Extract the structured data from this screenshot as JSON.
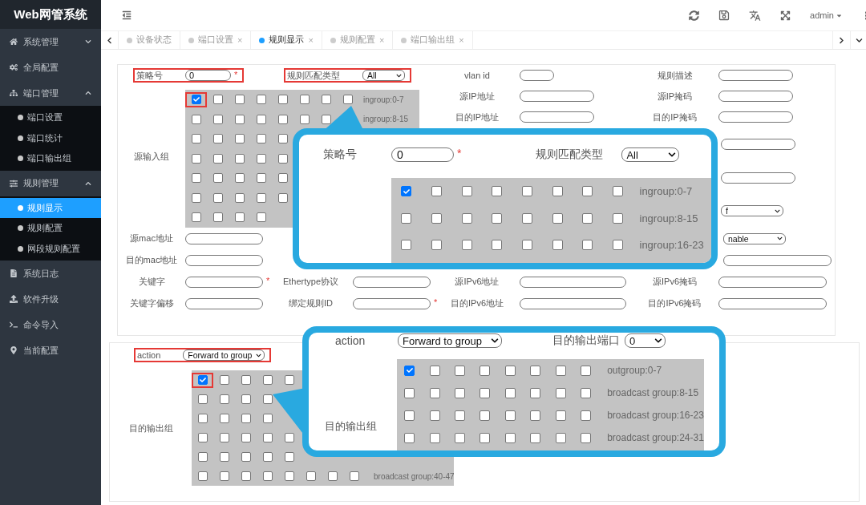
{
  "sidebar": {
    "title": "Web网管系统",
    "items": [
      {
        "label": "系统管理",
        "expanded": false
      },
      {
        "label": "全局配置"
      },
      {
        "label": "端口管理",
        "expanded": true,
        "children": [
          {
            "label": "端口设置",
            "selected": false
          },
          {
            "label": "端口统计",
            "selected": false
          },
          {
            "label": "端口输出组",
            "selected": false
          }
        ]
      },
      {
        "label": "规则管理",
        "expanded": true,
        "children": [
          {
            "label": "规则显示",
            "selected": true
          },
          {
            "label": "规则配置",
            "selected": false
          },
          {
            "label": "网段规则配置",
            "selected": false
          }
        ]
      },
      {
        "label": "系统日志"
      },
      {
        "label": "软件升级"
      },
      {
        "label": "命令导入"
      },
      {
        "label": "当前配置"
      }
    ]
  },
  "topbar": {
    "user": "admin"
  },
  "tabs": [
    {
      "label": "设备状态",
      "selected": false
    },
    {
      "label": "端口设置",
      "selected": false,
      "close": "×"
    },
    {
      "label": "规则显示",
      "selected": true,
      "close": "×"
    },
    {
      "label": "规则配置",
      "selected": false,
      "close": "×"
    },
    {
      "label": "端口输出组",
      "selected": false,
      "close": "×"
    }
  ],
  "rule_form": {
    "top_row": [
      {
        "label": "策略号",
        "field": {
          "kind": "input",
          "value": "0"
        },
        "mark": "*",
        "highlighted": true
      },
      {
        "label": "规则匹配类型",
        "field": {
          "kind": "select",
          "value": "All"
        },
        "highlighted": true
      },
      {
        "label": "vlan id",
        "field": {
          "kind": "input"
        }
      },
      {
        "label": "规则描述",
        "field": {
          "kind": "input"
        }
      }
    ],
    "input_group": {
      "label": "源输入组",
      "rows": [
        {
          "boxes": [
            {
              "checked": true,
              "highlighted": true
            },
            {
              "checked": false
            },
            {
              "checked": false
            },
            {
              "checked": false
            },
            {
              "checked": false
            },
            {
              "checked": false
            },
            {
              "checked": false
            },
            {
              "checked": false
            }
          ],
          "label": "ingroup:0-7"
        },
        {
          "boxes": [
            {
              "checked": false
            },
            {
              "checked": false
            },
            {
              "checked": false
            },
            {
              "checked": false
            },
            {
              "checked": false
            },
            {
              "checked": false
            },
            {
              "checked": false
            }
          ],
          "label": "ingroup:8-15"
        },
        {
          "boxes": [
            {
              "checked": false
            },
            {
              "checked": false
            },
            {
              "checked": false
            },
            {
              "checked": false
            },
            {
              "checked": false
            }
          ]
        },
        {
          "boxes": [
            {
              "checked": false
            },
            {
              "checked": false
            },
            {
              "checked": false
            },
            {
              "checked": false
            },
            {
              "checked": false
            }
          ]
        },
        {
          "boxes": [
            {
              "checked": false
            },
            {
              "checked": false
            },
            {
              "checked": false
            },
            {
              "checked": false
            },
            {
              "checked": false
            }
          ]
        },
        {
          "boxes": [
            {
              "checked": false
            },
            {
              "checked": false
            },
            {
              "checked": false
            },
            {
              "checked": false
            },
            {
              "checked": false
            }
          ]
        },
        {
          "boxes": [
            {
              "checked": false
            },
            {
              "checked": false
            },
            {
              "checked": false
            },
            {
              "checked": false
            }
          ]
        }
      ]
    },
    "side_rows": [
      [
        {
          "label": "源IP地址",
          "field": {
            "kind": "input"
          }
        },
        {
          "label": "源IP掩码",
          "field": {
            "kind": "input"
          }
        }
      ],
      [
        {
          "label": "目的IP地址",
          "field": {
            "kind": "input"
          }
        },
        {
          "label": "目的IP掩码",
          "field": {
            "kind": "input"
          }
        }
      ],
      [
        null,
        {
          "field": {
            "kind": "input"
          }
        }
      ],
      [
        null,
        {
          "field": {
            "kind": "input"
          }
        }
      ],
      [
        null,
        {
          "field": {
            "kind": "select",
            "value": "f"
          }
        }
      ]
    ],
    "rows": [
      [
        {
          "label": "源mac地址",
          "field": {
            "kind": "input"
          }
        },
        null,
        null,
        {
          "field": {
            "kind": "select",
            "value": "nable"
          }
        }
      ],
      [
        {
          "label": "目的mac地址",
          "field": {
            "kind": "input"
          }
        },
        null,
        null,
        {
          "field": {
            "kind": "input"
          }
        }
      ],
      [
        {
          "label": "关键字",
          "field": {
            "kind": "input"
          },
          "mark": "*"
        },
        {
          "label": "Ethertype协议",
          "field": {
            "kind": "input"
          }
        },
        {
          "label": "源IPv6地址",
          "field": {
            "kind": "input"
          }
        },
        {
          "label": "源IPv6掩码",
          "field": {
            "kind": "input"
          }
        }
      ],
      [
        {
          "label": "关键字偏移",
          "field": {
            "kind": "input"
          }
        },
        {
          "label": "绑定规则ID",
          "field": {
            "kind": "input"
          },
          "mark": "*"
        },
        {
          "label": "目的IPv6地址",
          "field": {
            "kind": "input"
          }
        },
        {
          "label": "目的IPv6掩码",
          "field": {
            "kind": "input"
          }
        }
      ]
    ]
  },
  "action_form": {
    "action": {
      "label": "action",
      "field": {
        "kind": "select",
        "value": "Forward to group"
      },
      "highlighted": true
    },
    "output_group": {
      "label": "目的输出组",
      "rows": [
        {
          "boxes": [
            {
              "checked": true,
              "highlighted": true
            },
            {
              "checked": false
            },
            {
              "checked": false
            },
            {
              "checked": false
            },
            {
              "checked": false
            }
          ]
        },
        {
          "boxes": [
            {
              "checked": false
            },
            {
              "checked": false
            },
            {
              "checked": false
            },
            {
              "checked": false
            }
          ]
        },
        {
          "boxes": [
            {
              "checked": false
            },
            {
              "checked": false
            },
            {
              "checked": false
            },
            {
              "checked": false
            }
          ]
        },
        {
          "boxes": [
            {
              "checked": false
            },
            {
              "checked": false
            },
            {
              "checked": false
            },
            {
              "checked": false
            },
            {
              "checked": false
            }
          ]
        },
        {
          "boxes": [
            {
              "checked": false
            },
            {
              "checked": false
            },
            {
              "checked": false
            },
            {
              "checked": false
            },
            {
              "checked": false
            }
          ]
        },
        {
          "boxes": [
            {
              "checked": false
            },
            {
              "checked": false
            },
            {
              "checked": false
            },
            {
              "checked": false
            },
            {
              "checked": false
            },
            {
              "checked": false
            },
            {
              "checked": false
            },
            {
              "checked": false
            }
          ],
          "label": "broadcast group:40-47"
        }
      ]
    }
  },
  "rule_callout": {
    "policy": {
      "label": "策略号",
      "field": {
        "kind": "input",
        "value": "0"
      },
      "mark": "*"
    },
    "match_type": {
      "label": "规则匹配类型",
      "field": {
        "kind": "select",
        "value": "All"
      }
    },
    "rows": [
      {
        "boxes": [
          {
            "checked": true
          },
          {
            "checked": false
          },
          {
            "checked": false
          },
          {
            "checked": false
          },
          {
            "checked": false
          },
          {
            "checked": false
          },
          {
            "checked": false
          },
          {
            "checked": false
          }
        ],
        "label": "ingroup:0-7"
      },
      {
        "boxes": [
          {
            "checked": false
          },
          {
            "checked": false
          },
          {
            "checked": false
          },
          {
            "checked": false
          },
          {
            "checked": false
          },
          {
            "checked": false
          },
          {
            "checked": false
          },
          {
            "checked": false
          }
        ],
        "label": "ingroup:8-15"
      },
      {
        "boxes": [
          {
            "checked": false
          },
          {
            "checked": false
          },
          {
            "checked": false
          },
          {
            "checked": false
          },
          {
            "checked": false
          },
          {
            "checked": false
          },
          {
            "checked": false
          },
          {
            "checked": false
          }
        ],
        "label": "ingroup:16-23"
      }
    ]
  },
  "action_callout": {
    "action": {
      "label": "action",
      "field": {
        "kind": "select",
        "value": "Forward to group"
      }
    },
    "port": {
      "label": "目的输出端口",
      "field": {
        "kind": "select",
        "value": "0"
      }
    },
    "group_label": "目的输出组",
    "rows": [
      {
        "boxes": [
          {
            "checked": true
          },
          {
            "checked": false
          },
          {
            "checked": false
          },
          {
            "checked": false
          },
          {
            "checked": false
          },
          {
            "checked": false
          },
          {
            "checked": false
          },
          {
            "checked": false
          }
        ],
        "label": "outgroup:0-7"
      },
      {
        "boxes": [
          {
            "checked": false
          },
          {
            "checked": false
          },
          {
            "checked": false
          },
          {
            "checked": false
          },
          {
            "checked": false
          },
          {
            "checked": false
          },
          {
            "checked": false
          },
          {
            "checked": false
          }
        ],
        "label": "broadcast group:8-15"
      },
      {
        "boxes": [
          {
            "checked": false
          },
          {
            "checked": false
          },
          {
            "checked": false
          },
          {
            "checked": false
          },
          {
            "checked": false
          },
          {
            "checked": false
          },
          {
            "checked": false
          },
          {
            "checked": false
          }
        ],
        "label": "broadcast group:16-23"
      },
      {
        "boxes": [
          {
            "checked": false
          },
          {
            "checked": false
          },
          {
            "checked": false
          },
          {
            "checked": false
          },
          {
            "checked": false
          },
          {
            "checked": false
          },
          {
            "checked": false
          },
          {
            "checked": false
          }
        ],
        "label": "broadcast group:24-31"
      }
    ]
  }
}
